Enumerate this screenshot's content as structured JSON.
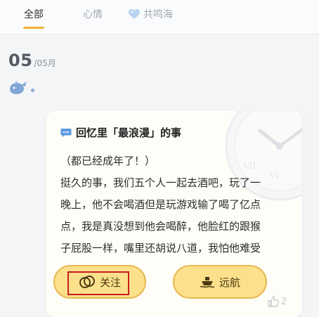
{
  "tabs": [
    {
      "label": "全部",
      "active": true
    },
    {
      "label": "心情",
      "active": false
    },
    {
      "label": "共鸣海",
      "active": false,
      "icon": "heart-icon"
    }
  ],
  "date": {
    "day": "05",
    "month": "/05月"
  },
  "card": {
    "title": "回忆里「最浪漫」的事",
    "lines": [
      "（都已经成年了！）",
      "挺久的事，我们五个人一起去酒吧，玩了一",
      "晚上，他不会喝酒但是玩游戏输了喝了亿点",
      "点，我是真没想到他会喝醉，他脸红的跟猴",
      "子屁股一样，嘴里还胡说八道，我怕他难受"
    ],
    "follow_label": "关注",
    "sail_label": "远航",
    "like_count": "2"
  },
  "colors": {
    "accent": "#f2b233",
    "button_fill": "#fde08c",
    "button_border": "#e8b84f",
    "highlight_box": "#c81e1e",
    "whale": "#7fa6d6"
  }
}
